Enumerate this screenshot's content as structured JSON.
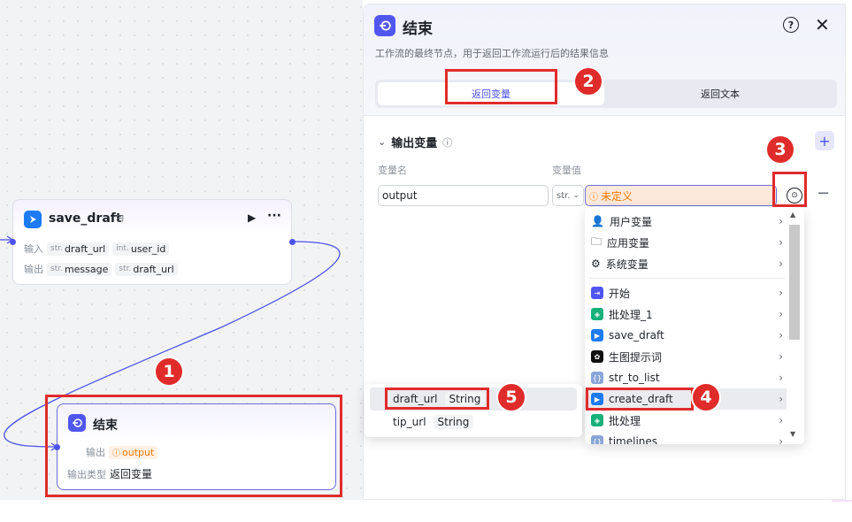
{
  "canvas": {
    "save_node": {
      "title": "save_draft",
      "input_label": "输入",
      "output_label": "输出",
      "inputs": [
        {
          "type": "str.",
          "name": "draft_url"
        },
        {
          "type": "int.",
          "name": "user_id"
        }
      ],
      "outputs": [
        {
          "type": "str.",
          "name": "message"
        },
        {
          "type": "str.",
          "name": "draft_url"
        }
      ]
    },
    "end_node": {
      "title": "结束",
      "output_label": "输出",
      "output_tag": "output",
      "output_type_label": "输出类型",
      "output_type_value": "返回变量"
    }
  },
  "panel": {
    "title": "结束",
    "description": "工作流的最终节点，用于返回工作流运行后的结果信息",
    "tabs": [
      {
        "label": "返回变量",
        "active": true
      },
      {
        "label": "返回文本",
        "active": false
      }
    ],
    "section_title": "输出变量",
    "col_name": "变量名",
    "col_value": "变量值",
    "row": {
      "name": "output",
      "type": "str.",
      "value": "未定义"
    }
  },
  "dropdown": {
    "items": [
      {
        "label": "用户变量",
        "icon": "user-icon"
      },
      {
        "label": "应用变量",
        "icon": "folder-icon"
      },
      {
        "label": "系统变量",
        "icon": "gear-icon"
      },
      {
        "label": "开始",
        "icon": "start-node-icon"
      },
      {
        "label": "批处理_1",
        "icon": "batch-icon"
      },
      {
        "label": "save_draft",
        "icon": "plugin-icon"
      },
      {
        "label": "生图提示词",
        "icon": "llm-icon"
      },
      {
        "label": "str_to_list",
        "icon": "code-icon"
      },
      {
        "label": "create_draft",
        "icon": "plugin-icon"
      },
      {
        "label": "批处理",
        "icon": "batch-icon"
      },
      {
        "label": "timelines",
        "icon": "code-icon"
      }
    ]
  },
  "submenu": {
    "items": [
      {
        "name": "draft_url",
        "type": "String"
      },
      {
        "name": "tip_url",
        "type": "String"
      }
    ]
  },
  "annotations": [
    "1",
    "2",
    "3",
    "4",
    "5"
  ],
  "colors": {
    "accent": "#4d53e8",
    "annotation_red": "#e02b2b",
    "warning": "#f57a00"
  }
}
